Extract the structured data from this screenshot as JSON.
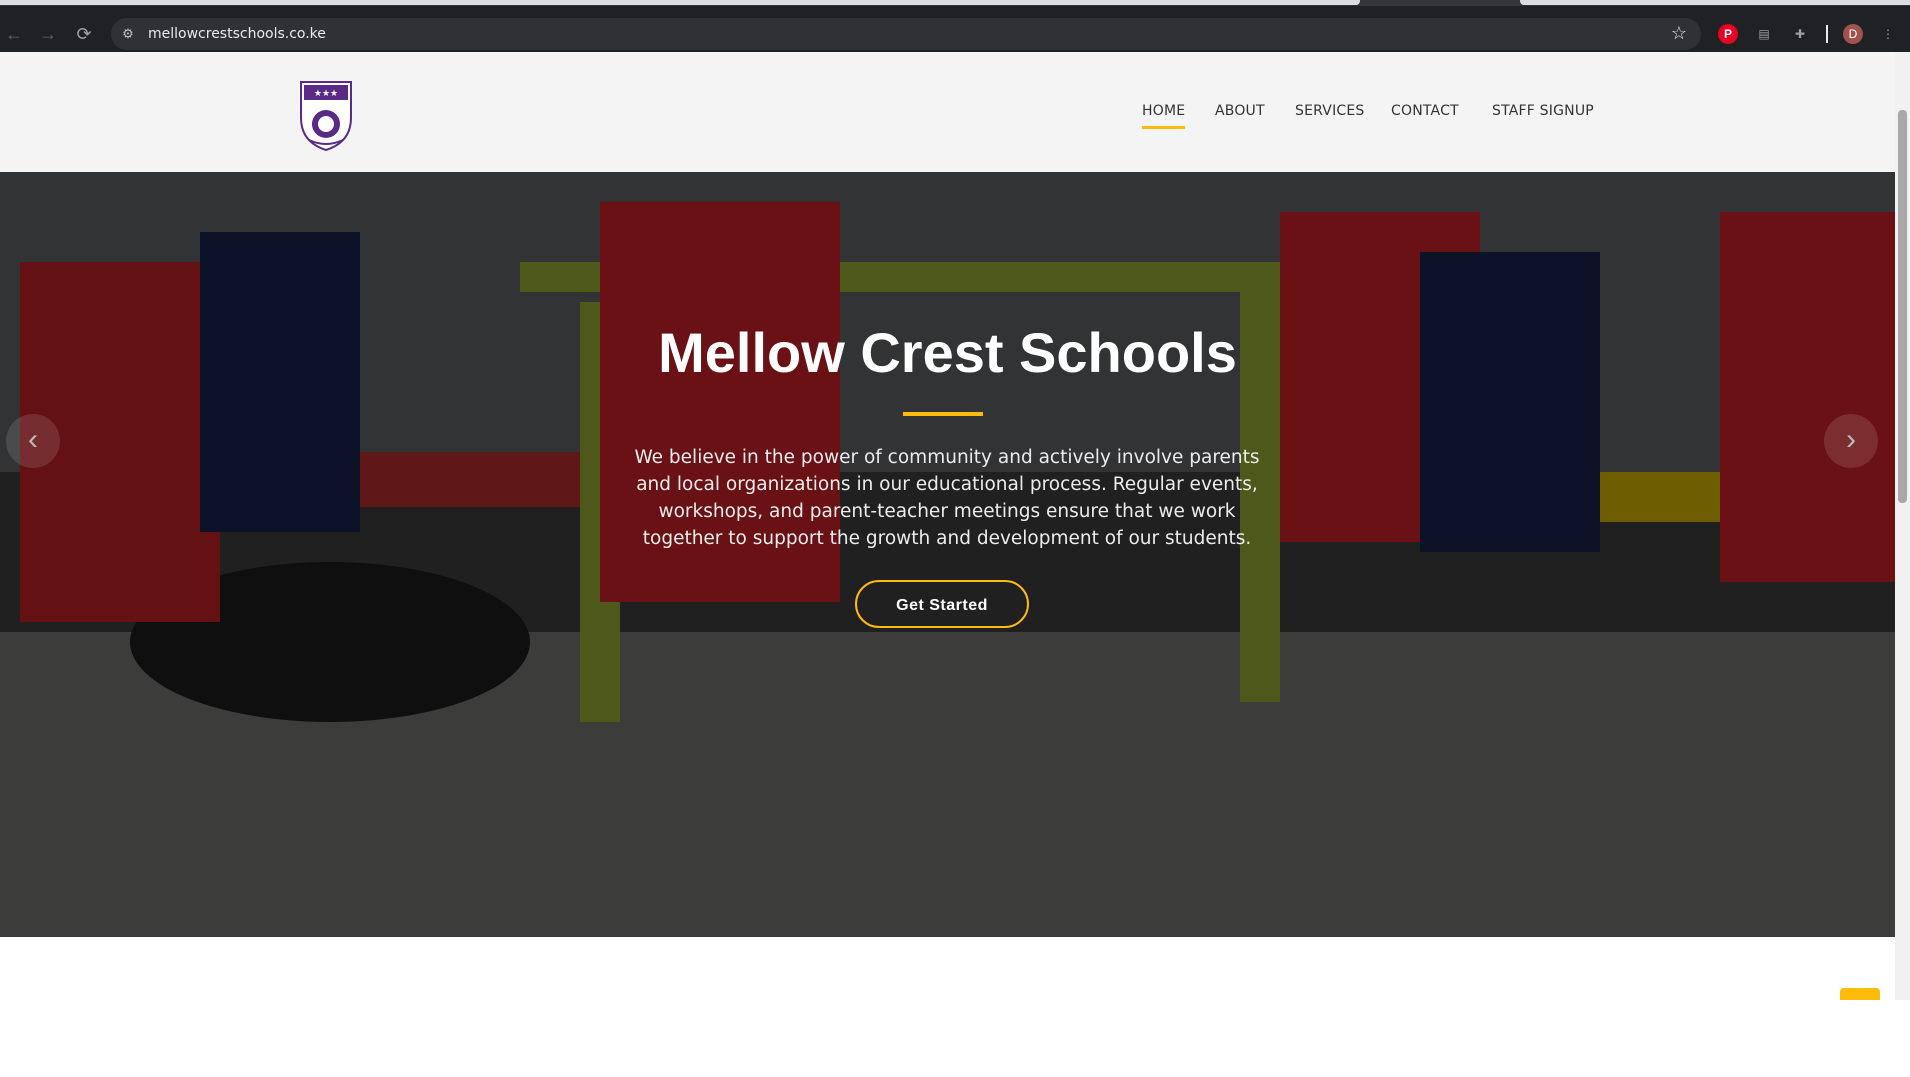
{
  "browser": {
    "url": "mellowcrestschools.co.ke",
    "profile_initial": "D"
  },
  "site": {
    "logo_name": "school-crest-logo",
    "nav": [
      {
        "label": "HOME",
        "active": true
      },
      {
        "label": "ABOUT",
        "active": false
      },
      {
        "label": "SERVICES",
        "active": false
      },
      {
        "label": "CONTACT",
        "active": false
      },
      {
        "label": "STAFF SIGNUP",
        "active": false
      }
    ]
  },
  "hero": {
    "title": "Mellow Crest Schools",
    "description": "We believe in the power of community and actively involve parents and local organizations in our educational process. Regular events, workshops, and parent-teacher meetings ensure that we work together to support the growth and development of our students.",
    "cta_label": "Get Started",
    "prev_arrow": "‹",
    "next_arrow": "›"
  },
  "colors": {
    "accent": "#ffbb0a",
    "header_bg": "#f4f4f4",
    "chrome_bg": "#202124"
  }
}
